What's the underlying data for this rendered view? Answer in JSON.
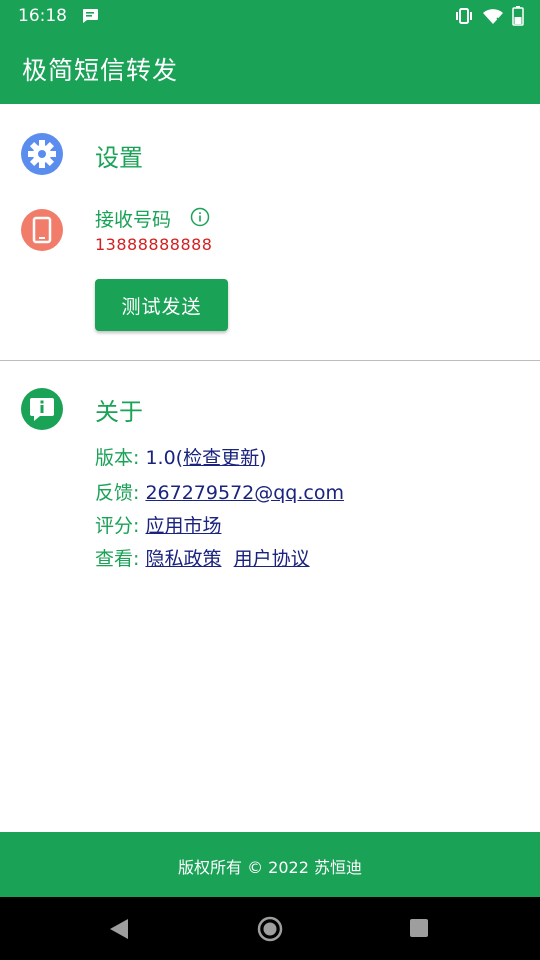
{
  "status_bar": {
    "time": "16:18"
  },
  "app": {
    "title": "极简短信转发"
  },
  "settings": {
    "title": "设置",
    "phone_label": "接收号码",
    "phone_number": "13888888888",
    "test_button": "测试发送"
  },
  "about": {
    "title": "关于",
    "version_label": "版本:",
    "version_value": "1.0(",
    "check_update": "检查更新",
    "version_suffix": ")",
    "feedback_label": "反馈:",
    "feedback_email": "267279572@qq.com",
    "rating_label": "评分:",
    "rating_link": "应用市场",
    "view_label": "查看:",
    "privacy_link": "隐私政策",
    "agreement_link": "用户协议"
  },
  "footer": {
    "text": "版权所有 © 2022 苏恒迪"
  },
  "colors": {
    "primary": "#1aa257",
    "error": "#d32020",
    "link": "#1a237e",
    "gear": "#5b8def",
    "phone": "#f27c6a"
  },
  "icons": [
    "message-icon",
    "vibrate-icon",
    "wifi-icon",
    "battery-icon",
    "gear-icon",
    "phone-icon",
    "info-icon",
    "chat-info-icon",
    "back-icon",
    "home-icon",
    "recents-icon"
  ]
}
